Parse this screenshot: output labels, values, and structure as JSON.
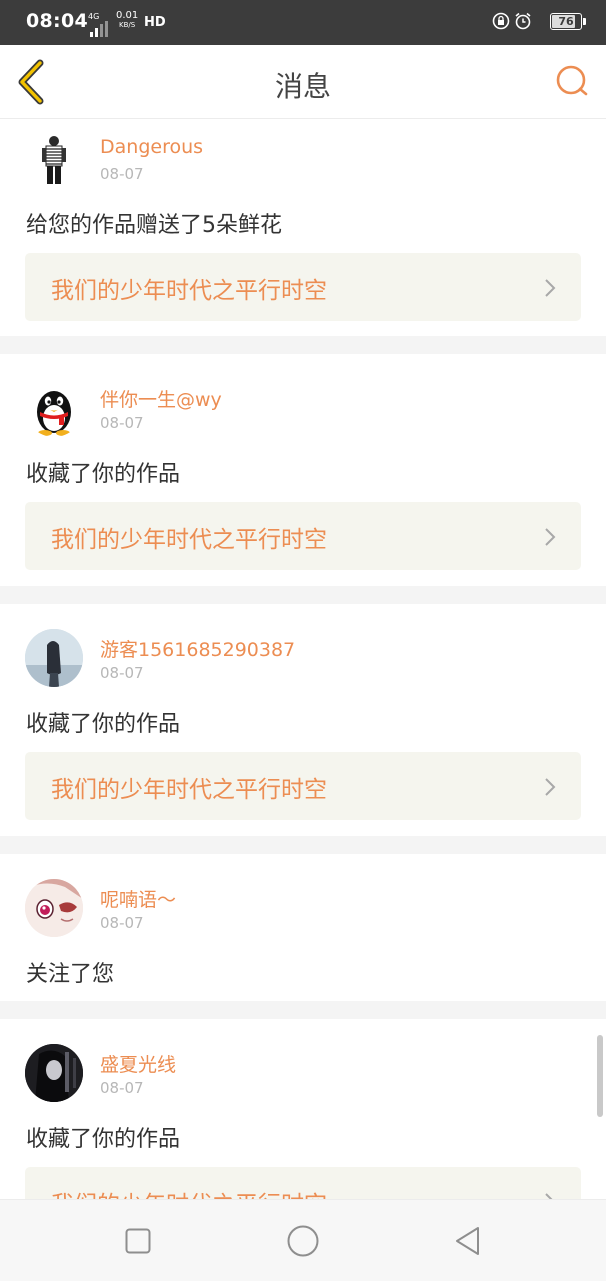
{
  "status_bar": {
    "time": "08:04",
    "network": "4G",
    "speed_value": "0.01",
    "speed_unit": "KB/S",
    "hd": "HD",
    "battery": "76",
    "icons": [
      "rotation-lock-icon",
      "alarm-icon",
      "battery-icon"
    ]
  },
  "header": {
    "title": "消息",
    "back_icon": "chevron-left-icon",
    "search_icon": "search-icon"
  },
  "messages": [
    {
      "user": "Dangerous",
      "date": "08-07",
      "action": "给您的作品赠送了5朵鲜花",
      "work": "我们的少年时代之平行时空"
    },
    {
      "user": "伴你一生@wy",
      "date": "08-07",
      "action": "收藏了你的作品",
      "work": "我们的少年时代之平行时空"
    },
    {
      "user": "游客1561685290387",
      "date": "08-07",
      "action": "收藏了你的作品",
      "work": "我们的少年时代之平行时空"
    },
    {
      "user": "呢喃语～",
      "date": "08-07",
      "action": "关注了您"
    },
    {
      "user": "盛夏光线",
      "date": "08-07",
      "action": "收藏了你的作品",
      "work": "我们的少年时代之平行时空"
    }
  ],
  "system_nav": [
    "recents-square-icon",
    "home-circle-icon",
    "back-triangle-icon"
  ],
  "colors": {
    "accent": "#ec8d52",
    "status_bar": "#3c3c3c",
    "work_bg": "#f5f5ee"
  }
}
